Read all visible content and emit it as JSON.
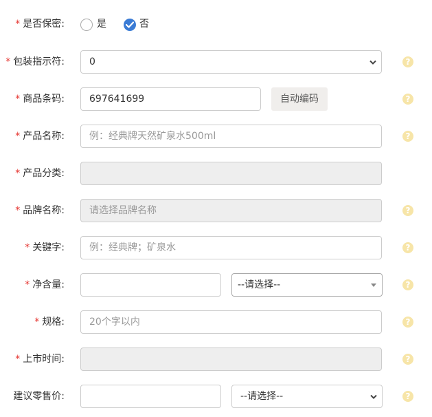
{
  "secret": {
    "label": "是否保密:",
    "required": "*",
    "yes": "是",
    "no": "否",
    "selected": "否"
  },
  "package": {
    "label": "包装指示符:",
    "required": "*",
    "value": "0"
  },
  "barcode": {
    "label": "商品条码:",
    "required": "*",
    "value": "697641699",
    "auto_button": "自动编码"
  },
  "product_name": {
    "label": "产品名称:",
    "required": "*",
    "placeholder": "例：经典牌天然矿泉水500ml"
  },
  "category": {
    "label": "产品分类:",
    "required": "*"
  },
  "brand": {
    "label": "品牌名称:",
    "required": "*",
    "placeholder": "请选择品牌名称"
  },
  "keywords": {
    "label": "关键字:",
    "required": "*",
    "placeholder": "例：经典牌；矿泉水"
  },
  "net_content": {
    "label": "净含量:",
    "required": "*",
    "unit_placeholder": "--请选择--"
  },
  "spec": {
    "label": "规格:",
    "required": "*",
    "placeholder": "20个字以内"
  },
  "launch_time": {
    "label": "上市时间:",
    "required": "*"
  },
  "price": {
    "label": "建议零售价:",
    "currency_placeholder": "--请选择--"
  },
  "help_glyph": "?",
  "icons": {
    "help": "question-circle-icon",
    "dropdown": "chevron-down-icon",
    "check": "check-icon"
  },
  "colors": {
    "required": "#e5322d",
    "radio_checked": "#3a7bd5",
    "help": "#f7e5a8",
    "disabled_bg": "#eeeeee"
  }
}
